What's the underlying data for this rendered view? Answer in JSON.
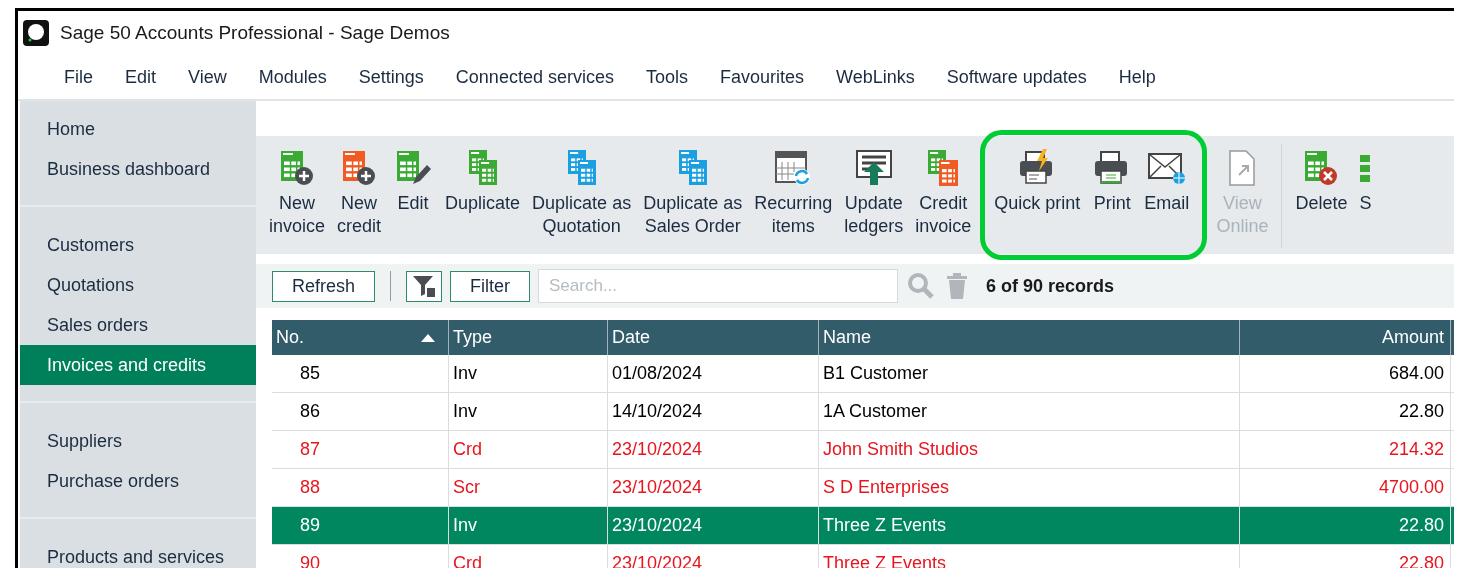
{
  "window": {
    "title": "Sage 50 Accounts Professional - Sage Demos"
  },
  "menu": [
    "File",
    "Edit",
    "View",
    "Modules",
    "Settings",
    "Connected services",
    "Tools",
    "Favourites",
    "WebLinks",
    "Software updates",
    "Help"
  ],
  "sidebar": {
    "groups": [
      {
        "items": [
          {
            "label": "Home",
            "selected": false
          },
          {
            "label": "Business dashboard",
            "selected": false
          }
        ]
      },
      {
        "items": [
          {
            "label": "Customers",
            "selected": false
          },
          {
            "label": "Quotations",
            "selected": false
          },
          {
            "label": "Sales orders",
            "selected": false
          },
          {
            "label": "Invoices and credits",
            "selected": true
          }
        ]
      },
      {
        "items": [
          {
            "label": "Suppliers",
            "selected": false
          },
          {
            "label": "Purchase orders",
            "selected": false
          }
        ]
      },
      {
        "items": [
          {
            "label": "Products and services",
            "selected": false
          }
        ]
      }
    ]
  },
  "toolbar": {
    "groups": [
      {
        "highlighted": false,
        "items": [
          {
            "label": "New invoice",
            "disabled": false
          },
          {
            "label": "New credit",
            "disabled": false
          },
          {
            "label": "Edit",
            "disabled": false
          },
          {
            "label": "Duplicate",
            "disabled": false
          },
          {
            "label": "Duplicate as Quotation",
            "disabled": false
          },
          {
            "label": "Duplicate as Sales Order",
            "disabled": false
          },
          {
            "label": "Recurring items",
            "disabled": false
          },
          {
            "label": "Update ledgers",
            "disabled": false
          },
          {
            "label": "Credit invoice",
            "disabled": false
          }
        ]
      },
      {
        "highlighted": true,
        "items": [
          {
            "label": "Quick print",
            "disabled": false
          },
          {
            "label": "Print",
            "disabled": false
          },
          {
            "label": "Email",
            "disabled": false
          }
        ]
      },
      {
        "highlighted": false,
        "items": [
          {
            "label": "View Online",
            "disabled": true
          }
        ]
      },
      {
        "highlighted": false,
        "items": [
          {
            "label": "Delete",
            "disabled": false
          },
          {
            "label": "S",
            "disabled": false
          }
        ]
      }
    ]
  },
  "filter_bar": {
    "refresh": "Refresh",
    "filter": "Filter",
    "search": {
      "placeholder": "Search..."
    },
    "record_count": "6 of 90 records"
  },
  "table": {
    "columns": [
      {
        "label": "No.",
        "sorted": true
      },
      {
        "label": "Type",
        "sorted": false
      },
      {
        "label": "Date",
        "sorted": false
      },
      {
        "label": "Name",
        "sorted": false
      },
      {
        "label": "Amount",
        "sorted": false
      }
    ],
    "rows": [
      {
        "cells": [
          "85",
          "Inv",
          "01/08/2024",
          "B1 Customer",
          "684.00"
        ],
        "kind": "invoice",
        "selected": false
      },
      {
        "cells": [
          "86",
          "Inv",
          "14/10/2024",
          "1A Customer",
          "22.80"
        ],
        "kind": "invoice",
        "selected": false
      },
      {
        "cells": [
          "87",
          "Crd",
          "23/10/2024",
          "John Smith Studios",
          "214.32"
        ],
        "kind": "credit",
        "selected": false
      },
      {
        "cells": [
          "88",
          "Scr",
          "23/10/2024",
          "S D Enterprises",
          "4700.00"
        ],
        "kind": "credit",
        "selected": false
      },
      {
        "cells": [
          "89",
          "Inv",
          "23/10/2024",
          "Three Z Events",
          "22.80"
        ],
        "kind": "invoice",
        "selected": true
      },
      {
        "cells": [
          "90",
          "Crd",
          "23/10/2024",
          "Three Z Events",
          "22.80"
        ],
        "kind": "credit",
        "selected": false
      }
    ]
  }
}
